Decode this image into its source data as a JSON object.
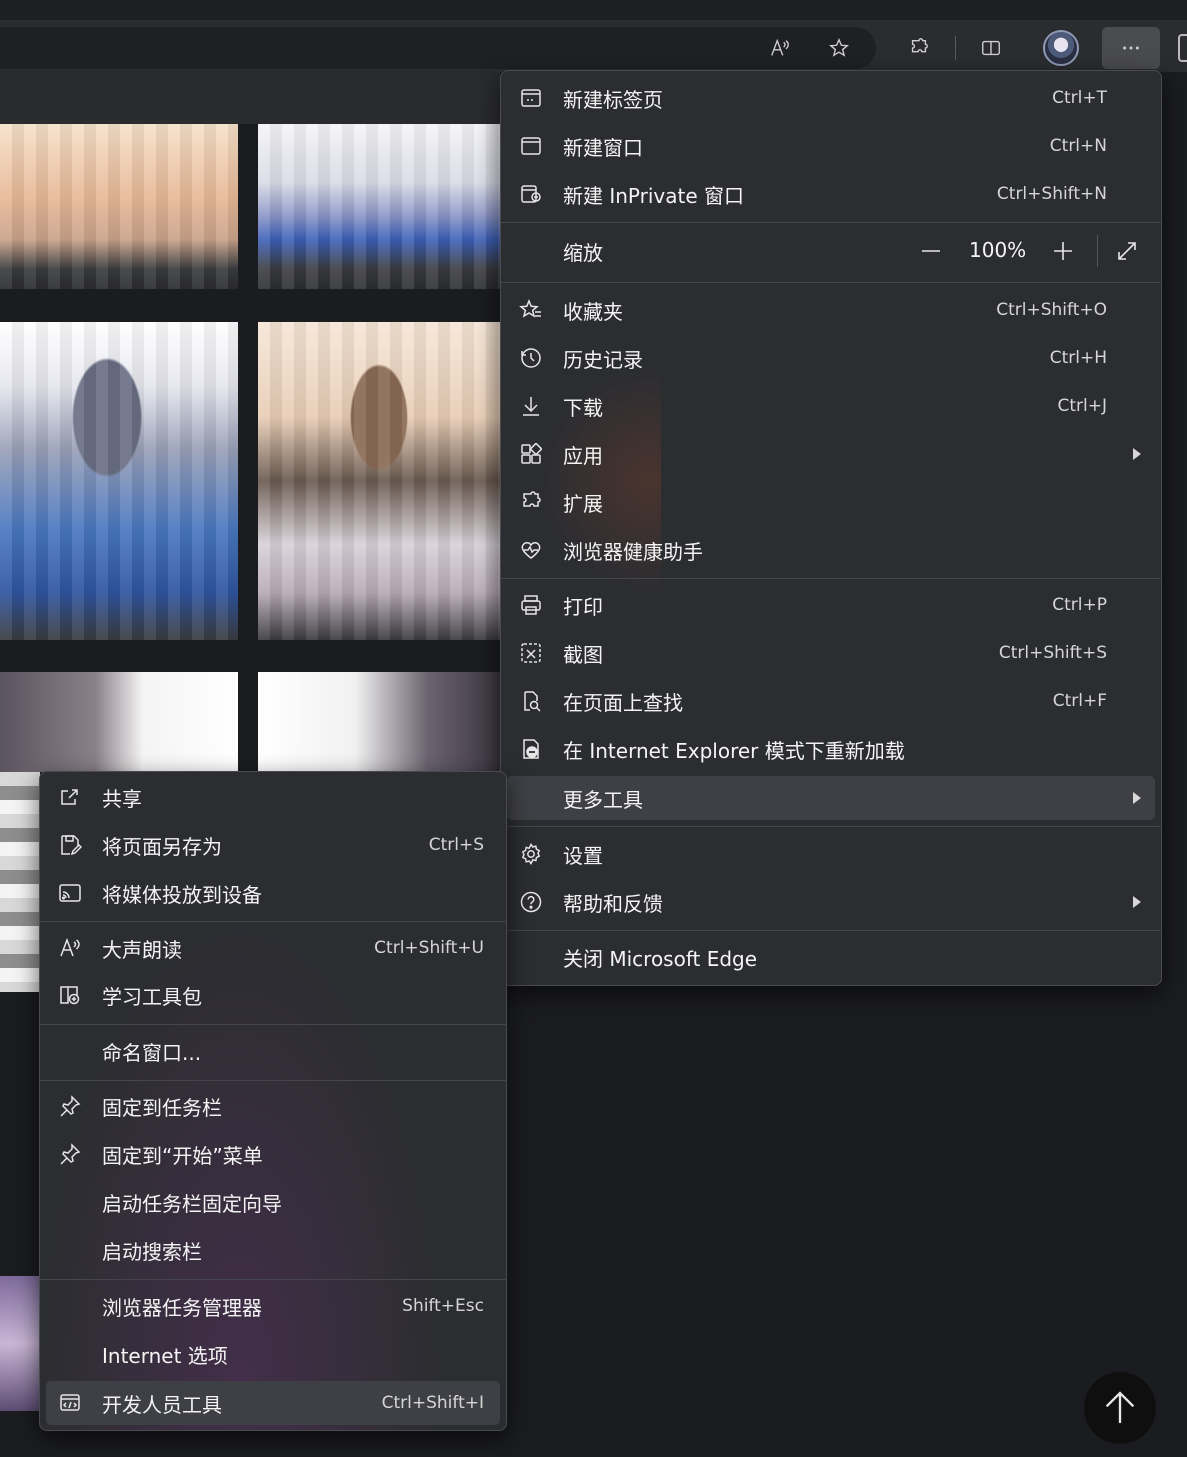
{
  "toolbar": {
    "icons": [
      "read-aloud-icon",
      "favorite-star-icon",
      "extensions-icon",
      "split-screen-icon",
      "profile-avatar",
      "more-options-icon"
    ]
  },
  "main_menu": {
    "items": [
      {
        "label": "新建标签页",
        "shortcut": "Ctrl+T",
        "icon": "new-tab-icon"
      },
      {
        "label": "新建窗口",
        "shortcut": "Ctrl+N",
        "icon": "new-window-icon"
      },
      {
        "label": "新建 InPrivate 窗口",
        "shortcut": "Ctrl+Shift+N",
        "icon": "inprivate-icon"
      },
      {
        "label": "收藏夹",
        "shortcut": "Ctrl+Shift+O",
        "icon": "favorites-icon"
      },
      {
        "label": "历史记录",
        "shortcut": "Ctrl+H",
        "icon": "history-icon"
      },
      {
        "label": "下载",
        "shortcut": "Ctrl+J",
        "icon": "download-icon"
      },
      {
        "label": "应用",
        "shortcut": "",
        "icon": "apps-icon"
      },
      {
        "label": "扩展",
        "shortcut": "",
        "icon": "extensions-icon"
      },
      {
        "label": "浏览器健康助手",
        "shortcut": "",
        "icon": "health-icon"
      },
      {
        "label": "打印",
        "shortcut": "Ctrl+P",
        "icon": "print-icon"
      },
      {
        "label": "截图",
        "shortcut": "Ctrl+Shift+S",
        "icon": "screenshot-icon"
      },
      {
        "label": "在页面上查找",
        "shortcut": "Ctrl+F",
        "icon": "find-icon"
      },
      {
        "label": "在 Internet Explorer 模式下重新加载",
        "shortcut": "",
        "icon": "ie-mode-icon"
      },
      {
        "label": "更多工具",
        "shortcut": "",
        "icon": ""
      },
      {
        "label": "设置",
        "shortcut": "",
        "icon": "settings-icon"
      },
      {
        "label": "帮助和反馈",
        "shortcut": "",
        "icon": "help-icon"
      },
      {
        "label": "关闭 Microsoft Edge",
        "shortcut": "",
        "icon": ""
      }
    ],
    "zoom": {
      "label": "缩放",
      "value": "100%"
    }
  },
  "sub_menu": {
    "items": [
      {
        "label": "共享",
        "shortcut": "",
        "icon": "share-icon"
      },
      {
        "label": "将页面另存为",
        "shortcut": "Ctrl+S",
        "icon": "save-page-icon"
      },
      {
        "label": "将媒体投放到设备",
        "shortcut": "",
        "icon": "cast-icon"
      },
      {
        "label": "大声朗读",
        "shortcut": "Ctrl+Shift+U",
        "icon": "read-aloud-icon"
      },
      {
        "label": "学习工具包",
        "shortcut": "",
        "icon": "learning-toolkit-icon"
      },
      {
        "label": "命名窗口...",
        "shortcut": "",
        "icon": ""
      },
      {
        "label": "固定到任务栏",
        "shortcut": "",
        "icon": "pin-icon"
      },
      {
        "label": "固定到“开始”菜单",
        "shortcut": "",
        "icon": "pin-icon"
      },
      {
        "label": "启动任务栏固定向导",
        "shortcut": "",
        "icon": ""
      },
      {
        "label": "启动搜索栏",
        "shortcut": "",
        "icon": ""
      },
      {
        "label": "浏览器任务管理器",
        "shortcut": "Shift+Esc",
        "icon": ""
      },
      {
        "label": "Internet 选项",
        "shortcut": "",
        "icon": ""
      },
      {
        "label": "开发人员工具",
        "shortcut": "Ctrl+Shift+I",
        "icon": "devtools-icon"
      }
    ]
  },
  "colors": {
    "menu_bg": "#2c2d31",
    "highlight": "#3f4045",
    "toolbar_bg": "#2b2c2f",
    "page_bg": "#1b1c1f"
  }
}
